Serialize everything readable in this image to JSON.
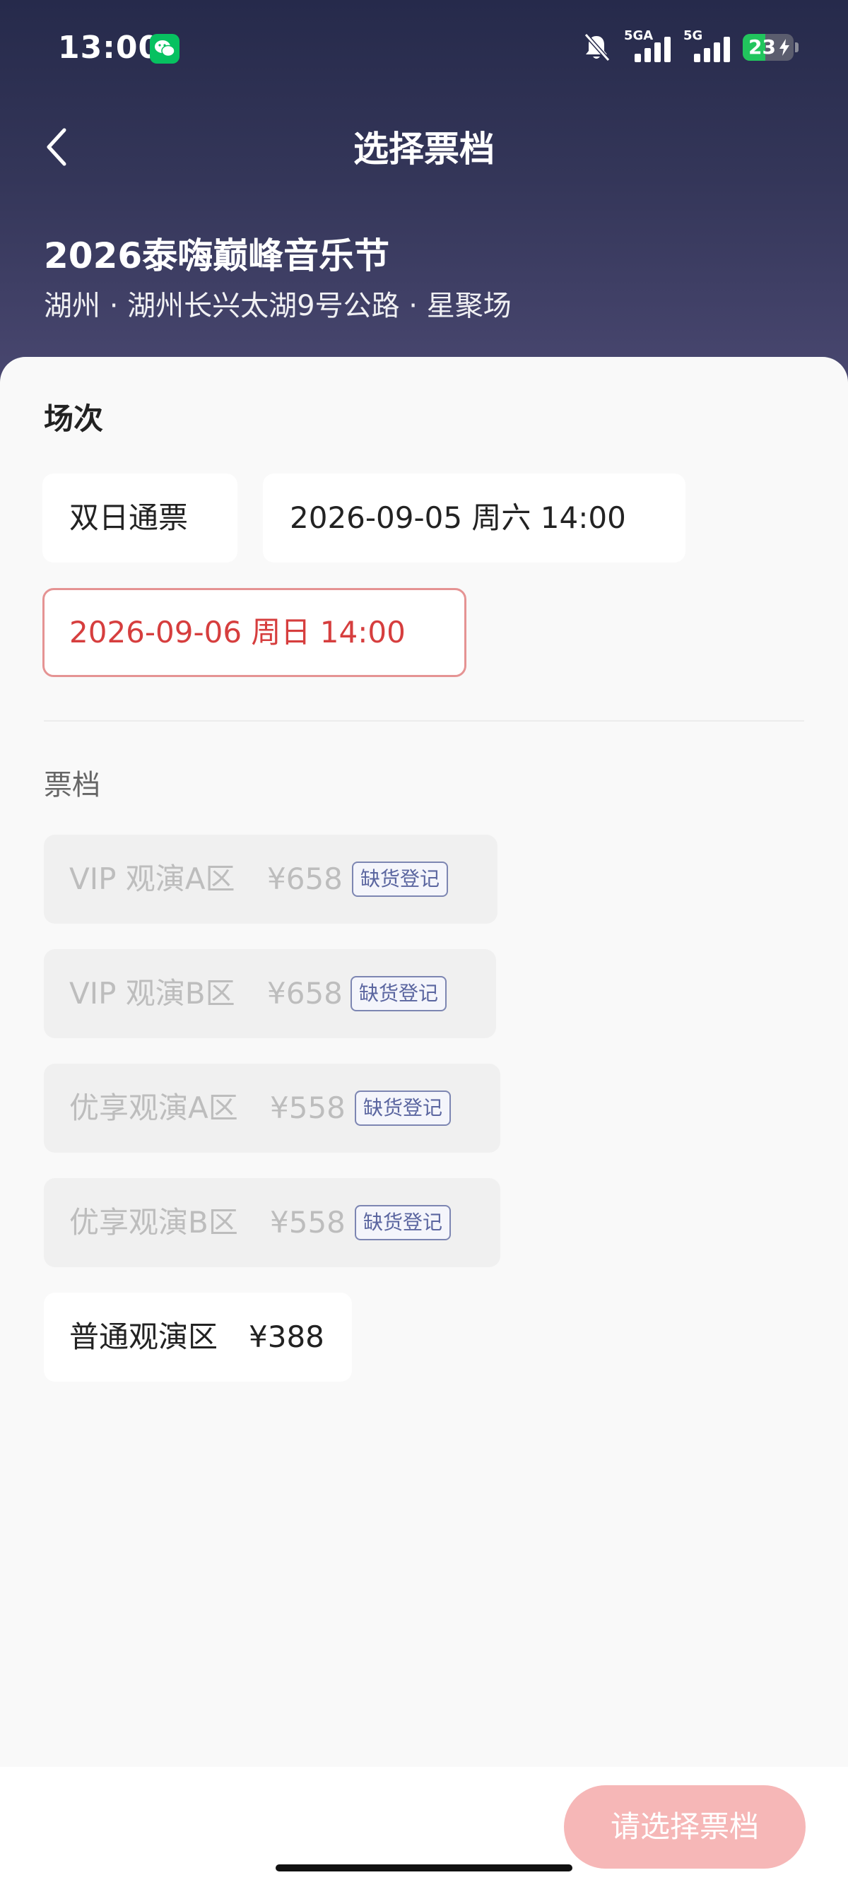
{
  "status_bar": {
    "time": "13:00",
    "network_1": "5GA",
    "network_2": "5G",
    "battery_level": "23",
    "icons": [
      "wechat-icon",
      "bell-muted-icon",
      "signal-icon",
      "battery-charging-icon"
    ]
  },
  "nav": {
    "back_icon": "chevron-left-icon",
    "title": "选择票档"
  },
  "event": {
    "title": "2026泰嗨巅峰音乐节",
    "venue": "湖州 · 湖州长兴太湖9号公路 · 星聚场"
  },
  "session": {
    "label": "场次",
    "options": [
      {
        "label": "双日通票",
        "selected": false
      },
      {
        "label": "2026-09-05 周六 14:00",
        "selected": false
      },
      {
        "label": "2026-09-06 周日 14:00",
        "selected": true
      }
    ]
  },
  "tiers": {
    "label": "票档",
    "items": [
      {
        "name": "VIP 观演A区",
        "price": "¥658",
        "badge": "缺货登记",
        "available": false
      },
      {
        "name": "VIP 观演B区",
        "price": "¥658",
        "badge": "缺货登记",
        "available": false
      },
      {
        "name": "优享观演A区",
        "price": "¥558",
        "badge": "缺货登记",
        "available": false
      },
      {
        "name": "优享观演B区",
        "price": "¥558",
        "badge": "缺货登记",
        "available": false
      },
      {
        "name": "普通观演区",
        "price": "¥388",
        "badge": "",
        "available": true
      }
    ]
  },
  "bottom": {
    "confirm_label": "请选择票档"
  },
  "colors": {
    "header_top": "#262a4b",
    "header_bottom": "#4a4871",
    "accent_red": "#d63e3e",
    "selected_border": "#e59393",
    "confirm_disabled": "#f6b7b7",
    "badge_border": "#7d86b2"
  }
}
